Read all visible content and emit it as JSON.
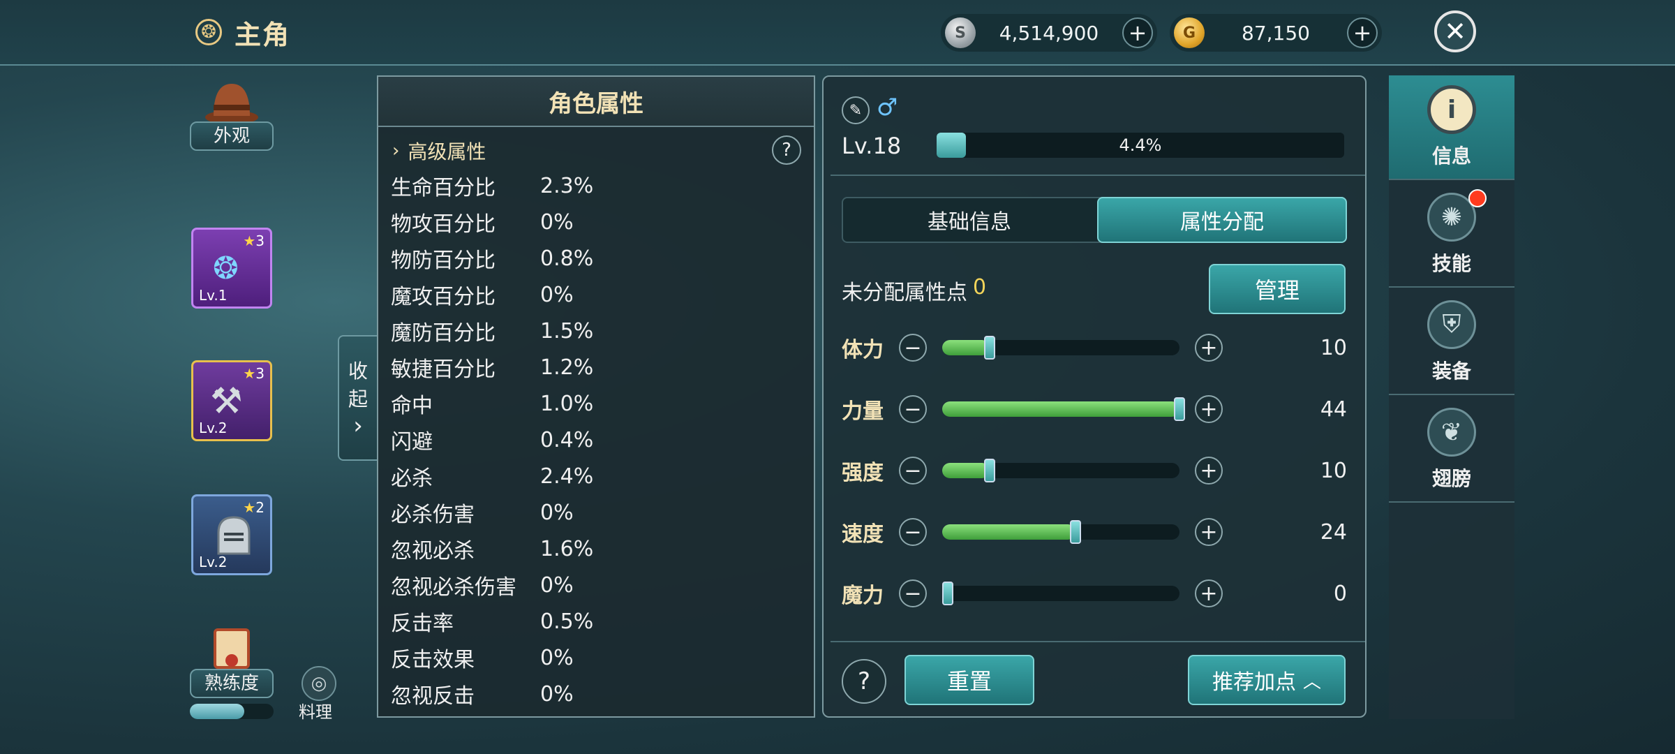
{
  "header": {
    "title": "主角",
    "icon": "wheel-icon",
    "silver": "4,514,900",
    "gold": "87,150",
    "add": "+",
    "close": "✕"
  },
  "left": {
    "appearance": "外观",
    "proficiency": "熟练度",
    "cooking": "料理",
    "slots": [
      {
        "stars": "3",
        "level": "Lv.1",
        "icon": "ring-icon"
      },
      {
        "stars": "3",
        "level": "Lv.2",
        "icon": "axe-icon"
      },
      {
        "stars": "2",
        "level": "Lv.2",
        "icon": "helmet-icon"
      }
    ]
  },
  "collapse": {
    "line1": "收",
    "line2": "起",
    "arrow": "›"
  },
  "attributes": {
    "title": "角色属性",
    "section": "高级属性",
    "help": "?",
    "rows": [
      {
        "name": "生命百分比",
        "value": "2.3%"
      },
      {
        "name": "物攻百分比",
        "value": "0%"
      },
      {
        "name": "物防百分比",
        "value": "0.8%"
      },
      {
        "name": "魔攻百分比",
        "value": "0%"
      },
      {
        "name": "魔防百分比",
        "value": "1.5%"
      },
      {
        "name": "敏捷百分比",
        "value": "1.2%"
      },
      {
        "name": "命中",
        "value": "1.0%"
      },
      {
        "name": "闪避",
        "value": "0.4%"
      },
      {
        "name": "必杀",
        "value": "2.4%"
      },
      {
        "name": "必杀伤害",
        "value": "0%"
      },
      {
        "name": "忽视必杀",
        "value": "1.6%"
      },
      {
        "name": "忽视必杀伤害",
        "value": "0%"
      },
      {
        "name": "反击率",
        "value": "0.5%"
      },
      {
        "name": "反击效果",
        "value": "0%"
      },
      {
        "name": "忽视反击",
        "value": "0%"
      }
    ]
  },
  "character": {
    "level": "Lv.18",
    "exp_text": "4.4%",
    "exp_fraction": 0.044,
    "gender": "♂"
  },
  "tabs": {
    "basic": "基础信息",
    "allocate": "属性分配"
  },
  "allocation": {
    "unassigned_label": "未分配属性点",
    "unassigned_value": "0",
    "manage": "管理",
    "stats": [
      {
        "name": "体力",
        "value": "10",
        "fill": 0.18
      },
      {
        "name": "力量",
        "value": "44",
        "fill": 1.0
      },
      {
        "name": "强度",
        "value": "10",
        "fill": 0.18
      },
      {
        "name": "速度",
        "value": "24",
        "fill": 0.55
      },
      {
        "name": "魔力",
        "value": "0",
        "fill": 0.0
      }
    ],
    "minus": "−",
    "plus": "+"
  },
  "footer": {
    "help": "?",
    "reset": "重置",
    "recommend": "推荐加点"
  },
  "nav": {
    "info": "信息",
    "skill": "技能",
    "equip": "装备",
    "wings": "翅膀"
  }
}
